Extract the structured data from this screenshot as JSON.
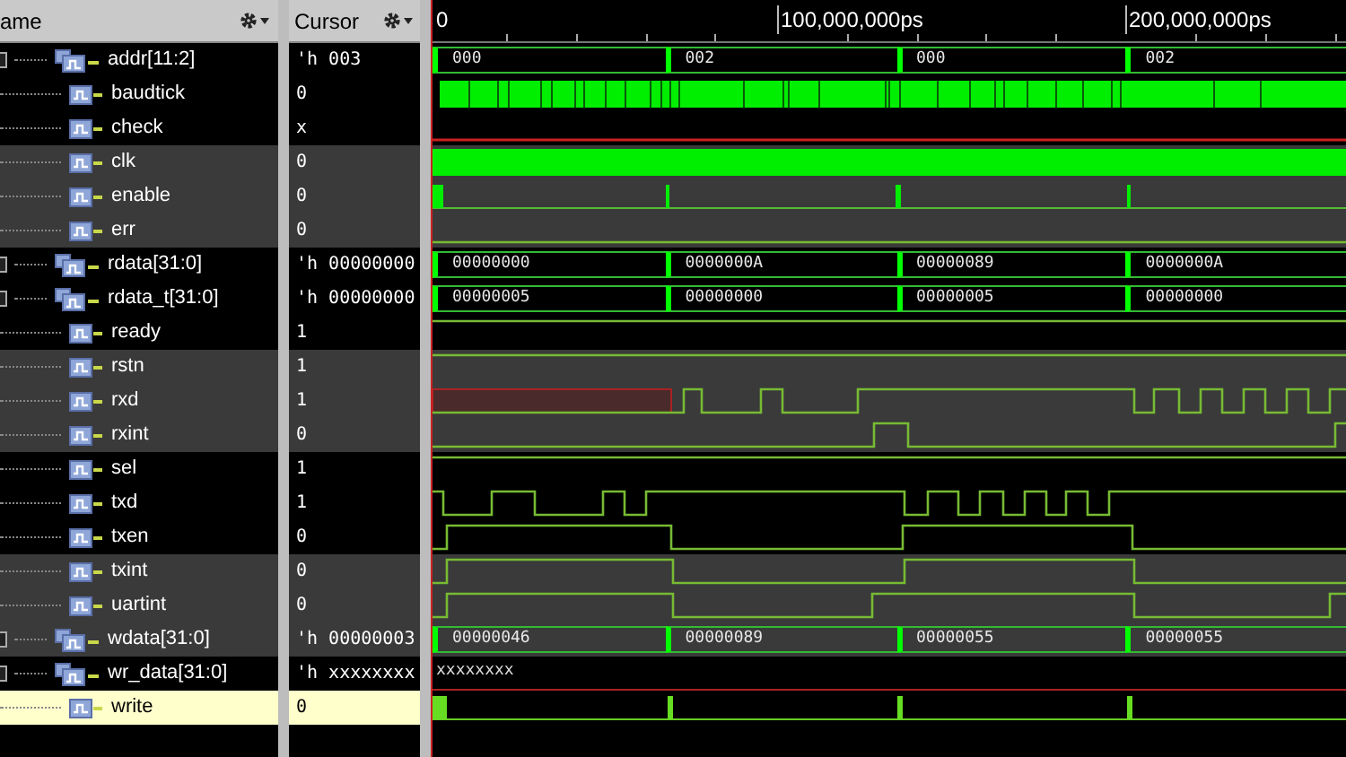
{
  "columns": {
    "name": "ame",
    "cursor": "Cursor"
  },
  "timeline": [
    "0",
    "100,000,000ps",
    "200,000,000ps"
  ],
  "signals": [
    {
      "name": "addr[11:2]",
      "kind": "bus",
      "value": "'h 003",
      "selected": false,
      "segments": [
        "000",
        "002",
        "000",
        "002"
      ]
    },
    {
      "name": "baudtick",
      "kind": "bit",
      "value": "0",
      "selected": false
    },
    {
      "name": "check",
      "kind": "bit",
      "value": "x",
      "selected": false
    },
    {
      "name": "clk",
      "kind": "bit",
      "value": "0",
      "selected": false
    },
    {
      "name": "enable",
      "kind": "bit",
      "value": "0",
      "selected": false
    },
    {
      "name": "err",
      "kind": "bit",
      "value": "0",
      "selected": false
    },
    {
      "name": "rdata[31:0]",
      "kind": "bus",
      "value": "'h 00000000",
      "selected": false,
      "segments": [
        "00000000",
        "0000000A",
        "00000089",
        "0000000A"
      ]
    },
    {
      "name": "rdata_t[31:0]",
      "kind": "bus",
      "value": "'h 00000000",
      "selected": false,
      "segments": [
        "00000005",
        "00000000",
        "00000005",
        "00000000"
      ]
    },
    {
      "name": "ready",
      "kind": "bit",
      "value": "1",
      "selected": false
    },
    {
      "name": "rstn",
      "kind": "bit",
      "value": "1",
      "selected": false
    },
    {
      "name": "rxd",
      "kind": "bit",
      "value": "1",
      "selected": false
    },
    {
      "name": "rxint",
      "kind": "bit",
      "value": "0",
      "selected": false
    },
    {
      "name": "sel",
      "kind": "bit",
      "value": "1",
      "selected": false
    },
    {
      "name": "txd",
      "kind": "bit",
      "value": "1",
      "selected": false
    },
    {
      "name": "txen",
      "kind": "bit",
      "value": "0",
      "selected": false
    },
    {
      "name": "txint",
      "kind": "bit",
      "value": "0",
      "selected": false
    },
    {
      "name": "uartint",
      "kind": "bit",
      "value": "0",
      "selected": false
    },
    {
      "name": "wdata[31:0]",
      "kind": "bus",
      "value": "'h 00000003",
      "selected": false,
      "segments": [
        "00000046",
        "00000089",
        "00000055",
        "00000055"
      ]
    },
    {
      "name": "wr_data[31:0]",
      "kind": "bus",
      "value": "'h xxxxxxxx",
      "selected": false,
      "segments": [
        "xxxxxxxx"
      ]
    },
    {
      "name": "write",
      "kind": "bit",
      "value": "0",
      "selected": true
    }
  ]
}
